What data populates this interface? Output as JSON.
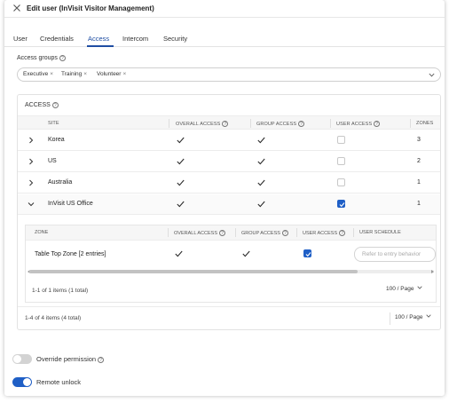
{
  "header": {
    "title": "Edit user (InVisit Visitor Management)",
    "close_icon": "close-icon"
  },
  "tabs": [
    {
      "label": "User",
      "active": false
    },
    {
      "label": "Credentials",
      "active": false
    },
    {
      "label": "Access",
      "active": true
    },
    {
      "label": "Intercom",
      "active": false
    },
    {
      "label": "Security",
      "active": false
    }
  ],
  "access_groups": {
    "label": "Access groups",
    "chips": [
      "Executive",
      "Training",
      "Volunteer"
    ]
  },
  "access_table": {
    "title": "ACCESS",
    "columns": [
      "SITE",
      "OVERALL ACCESS",
      "GROUP ACCESS",
      "USER ACCESS",
      "ZONES"
    ],
    "rows": [
      {
        "site": "Korea",
        "overall": true,
        "group": true,
        "user": false,
        "zones": "3",
        "expanded": false
      },
      {
        "site": "US",
        "overall": true,
        "group": true,
        "user": false,
        "zones": "2",
        "expanded": false
      },
      {
        "site": "Australia",
        "overall": true,
        "group": true,
        "user": false,
        "zones": "1",
        "expanded": false
      },
      {
        "site": "InVisit US Office",
        "overall": true,
        "group": true,
        "user": true,
        "zones": "1",
        "expanded": true
      }
    ],
    "footer": {
      "count": "1-4 of 4 items (4 total)",
      "per_page": "100 / Page"
    }
  },
  "zones_table": {
    "columns": [
      "ZONE",
      "OVERALL ACCESS",
      "GROUP ACCESS",
      "USER ACCESS",
      "USER SCHEDULE"
    ],
    "rows": [
      {
        "zone": "Table Top Zone [2 entries]",
        "overall": true,
        "group": true,
        "user": true,
        "schedule_placeholder": "Refer to entry behavior"
      }
    ],
    "footer": {
      "count": "1-1 of 1 items (1 total)",
      "per_page": "100 / Page"
    }
  },
  "toggles": {
    "override_permission": {
      "label": "Override permission",
      "on": false
    },
    "remote_unlock": {
      "label": "Remote unlock",
      "on": true
    }
  },
  "colors": {
    "accent": "#1f5fc6",
    "tab_active": "#1f4ea3"
  }
}
